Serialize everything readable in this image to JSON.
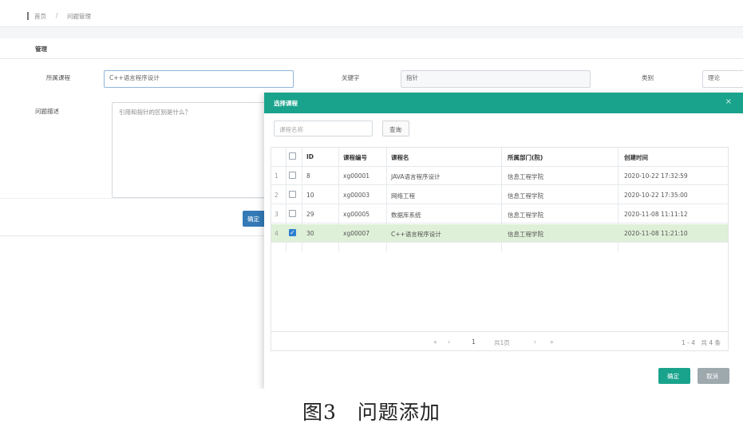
{
  "breadcrumb": {
    "home": "首页",
    "separator": "/",
    "current": "问题管理"
  },
  "section": {
    "title": "管理"
  },
  "form": {
    "course_label": "所属课程",
    "course_value": "C++语言程序设计",
    "keyword_label": "关键字",
    "keyword_value": "指针",
    "type_label": "类别",
    "type_value": "理论",
    "desc_label": "问题描述",
    "desc_value": "引用和指针的区别是什么？",
    "save_label": "确定"
  },
  "modal": {
    "title": "选择课程",
    "close": "×",
    "search_placeholder": "课程名称",
    "search_button": "查询",
    "columns": [
      "ID",
      "课程编号",
      "课程名",
      "所属部门(院)",
      "创建时间"
    ],
    "rows": [
      {
        "n": "1",
        "checked": false,
        "id": "8",
        "code": "xg00001",
        "name": "JAVA语言程序设计",
        "dept": "信息工程学院",
        "time": "2020-10-22 17:32:59"
      },
      {
        "n": "2",
        "checked": false,
        "id": "10",
        "code": "xg00003",
        "name": "网络工程",
        "dept": "信息工程学院",
        "time": "2020-10-22 17:35:00"
      },
      {
        "n": "3",
        "checked": false,
        "id": "29",
        "code": "xg00005",
        "name": "数据库系统",
        "dept": "信息工程学院",
        "time": "2020-11-08 11:11:12"
      },
      {
        "n": "4",
        "checked": true,
        "id": "30",
        "code": "xg00007",
        "name": "C++语言程序设计",
        "dept": "信息工程学院",
        "time": "2020-11-08 11:21:10"
      }
    ],
    "pager": {
      "first": "«",
      "prev": "‹",
      "page": "1",
      "total_pages": "共1页",
      "next": "›",
      "last": "»",
      "range": "1 - 4　共 4 条"
    },
    "ok_label": "确定",
    "cancel_label": "取消"
  },
  "caption": "图3　问题添加",
  "colors": {
    "modal_header": "#19a38c",
    "selected_row": "#dff0d8",
    "primary_button": "#337ab7"
  }
}
